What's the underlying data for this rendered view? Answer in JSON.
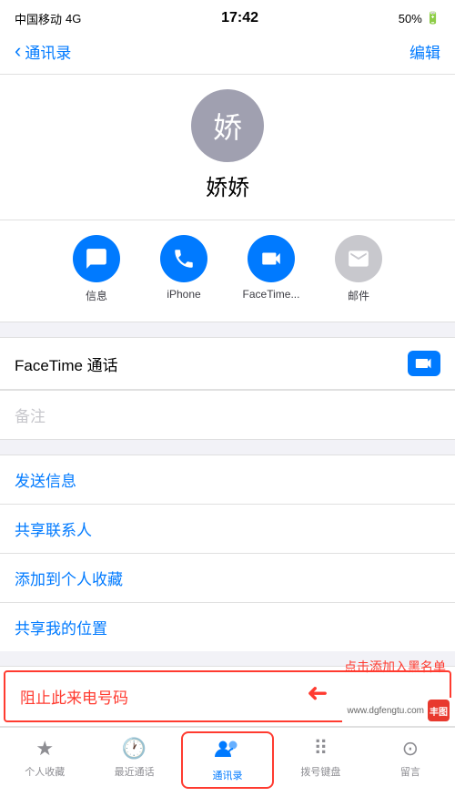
{
  "statusBar": {
    "carrier": "中国移动",
    "network": "4G",
    "time": "17:42",
    "battery": "50%"
  },
  "navBar": {
    "backLabel": "通讯录",
    "editLabel": "编辑"
  },
  "contact": {
    "avatarChar": "娇",
    "name": "娇娇"
  },
  "actions": [
    {
      "id": "message",
      "icon": "💬",
      "label": "信息",
      "color": "blue"
    },
    {
      "id": "phone",
      "icon": "📞",
      "label": "iPhone",
      "color": "blue"
    },
    {
      "id": "facetime-video",
      "icon": "📹",
      "label": "FaceTime...",
      "color": "blue"
    },
    {
      "id": "mail",
      "icon": "✉",
      "label": "邮件",
      "color": "gray"
    }
  ],
  "facetime": {
    "label": "FaceTime 通话",
    "icon": "📹"
  },
  "notes": {
    "placeholder": "备注"
  },
  "listItems": [
    {
      "id": "send-message",
      "label": "发送信息"
    },
    {
      "id": "share-contact",
      "label": "共享联系人"
    },
    {
      "id": "add-favorite",
      "label": "添加到个人收藏"
    },
    {
      "id": "share-location",
      "label": "共享我的位置"
    }
  ],
  "blockItem": {
    "label": "阻止此来电号码"
  },
  "annotation": {
    "text": "点击添加入黑名单"
  },
  "tabBar": {
    "items": [
      {
        "id": "favorites",
        "icon": "★",
        "label": "个人收藏",
        "active": false
      },
      {
        "id": "recents",
        "icon": "🕐",
        "label": "最近通话",
        "active": false
      },
      {
        "id": "contacts",
        "icon": "👥",
        "label": "通讯录",
        "active": true
      },
      {
        "id": "keypad",
        "icon": "⠿",
        "label": "拨号键盘",
        "active": false
      },
      {
        "id": "voicemail",
        "icon": "⊙",
        "label": "留言",
        "active": false
      }
    ]
  },
  "watermark": {
    "site": "www.dgfengtu.com",
    "logoText": "丰图"
  }
}
